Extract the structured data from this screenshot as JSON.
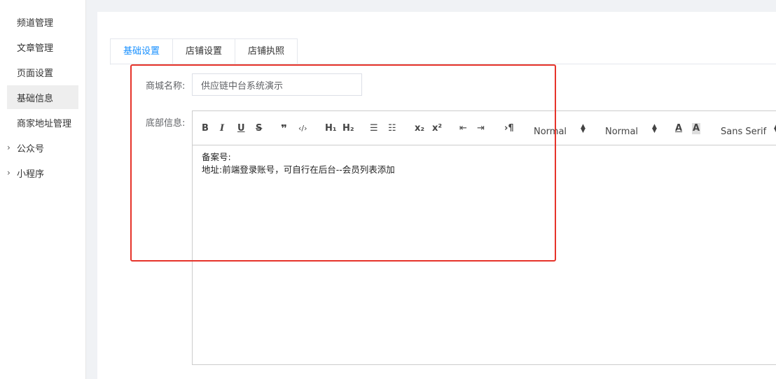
{
  "sidebar": {
    "items": [
      {
        "label": "频道管理"
      },
      {
        "label": "文章管理"
      },
      {
        "label": "页面设置"
      },
      {
        "label": "基础信息"
      },
      {
        "label": "商家地址管理"
      }
    ],
    "active": "基础信息",
    "groups": [
      {
        "label": "公众号",
        "icon": "chevron-right-icon"
      },
      {
        "label": "小程序",
        "icon": "chevron-right-icon"
      }
    ]
  },
  "tabs": [
    {
      "label": "基础设置"
    },
    {
      "label": "店铺设置"
    },
    {
      "label": "店铺执照"
    }
  ],
  "active_tab": "基础设置",
  "form": {
    "shop_name_label": "商城名称:",
    "shop_name_value": "供应链中台系统演示",
    "footer_label": "底部信息:"
  },
  "editor": {
    "toolbar": {
      "bold": "B",
      "italic": "I",
      "underline": "U",
      "strike": "S",
      "blockquote": "❞",
      "code": "‹/›",
      "h1": "H₁",
      "h2": "H₂",
      "ordered_list": "☰",
      "bullet_list": "☷",
      "subscript": "x₂",
      "superscript": "x²",
      "outdent": "⇤",
      "indent": "⇥",
      "direction": "›¶",
      "size_select": "Normal",
      "header_select": "Normal",
      "font_color": "A",
      "background": "A",
      "font_select": "Sans Serif"
    },
    "content_lines": [
      "备案号:",
      "地址:前端登录账号，可自行在后台--会员列表添加"
    ]
  },
  "colors": {
    "accent": "#1890ff",
    "highlight_border": "#e6332a",
    "active_sidebar_bg": "#eeeeee"
  }
}
